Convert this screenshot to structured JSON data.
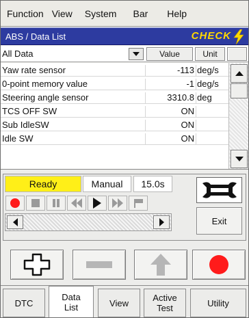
{
  "menu": [
    "Function",
    "View",
    "System",
    "Bar",
    "Help"
  ],
  "header": {
    "title": "ABS / Data List",
    "badge": "CHECK"
  },
  "list_header": {
    "filter_value": "All Data",
    "value_label": "Value",
    "unit_label": "Unit"
  },
  "rows": [
    {
      "name": "Yaw rate sensor",
      "value": "-113",
      "unit": "deg/s"
    },
    {
      "name": "0-point memory value",
      "value": "-1",
      "unit": "deg/s"
    },
    {
      "name": "Steering angle sensor",
      "value": "3310.8",
      "unit": "deg"
    },
    {
      "name": "TCS OFF SW",
      "value": "ON",
      "unit": ""
    },
    {
      "name": "Sub IdleSW",
      "value": "ON",
      "unit": ""
    },
    {
      "name": "Idle SW",
      "value": "ON",
      "unit": ""
    }
  ],
  "status": {
    "ready": "Ready",
    "mode": "Manual",
    "interval": "15.0s"
  },
  "exit_label": "Exit",
  "tabs": [
    {
      "label": "DTC"
    },
    {
      "label": "Data List"
    },
    {
      "label": "View"
    },
    {
      "label": "Active Test"
    },
    {
      "label": "Utility"
    }
  ],
  "colors": {
    "title_bg": "#2d3ba0",
    "check": "#ffd800",
    "ready_bg": "#ffef18",
    "record": "#ff1b1b"
  }
}
